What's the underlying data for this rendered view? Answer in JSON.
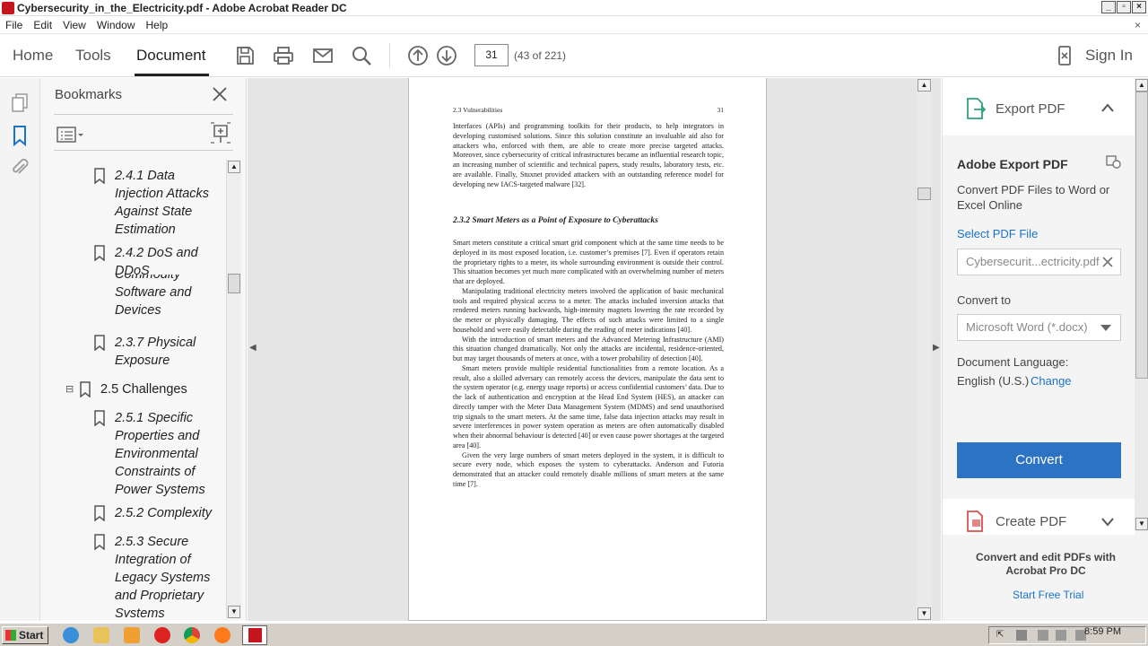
{
  "window": {
    "title": "Cybersecurity_in_the_Electricity.pdf - Adobe Acrobat Reader DC",
    "controls": [
      "_",
      "▫",
      "×"
    ]
  },
  "menu": {
    "items": [
      "File",
      "Edit",
      "View",
      "Window",
      "Help"
    ],
    "close": "×"
  },
  "toolbar": {
    "tabs": [
      "Home",
      "Tools",
      "Document"
    ],
    "active_tab": "Document",
    "page_value": "31",
    "page_count": "(43 of 221)",
    "sign_in": "Sign In"
  },
  "bookmarks": {
    "title": "Bookmarks",
    "items": [
      {
        "label": "2.4.1 Data\nInjection Attacks\nAgainst State\nEstimation"
      },
      {
        "label": "2.4.2 DoS and\nDDoS"
      },
      {
        "label": "Commodity\nSoftware and\nDevices"
      },
      {
        "label": "2.3.7 Physical\nExposure"
      },
      {
        "label": "2.5 Challenges",
        "toggle": "⊟"
      },
      {
        "label": "2.5.1 Specific\nProperties and\nEnvironmental\nConstraints of\nPower Systems"
      },
      {
        "label": "2.5.2 Complexity"
      },
      {
        "label": "2.5.3 Secure\nIntegration of\nLegacy Systems\nand Proprietary\nSystems"
      }
    ]
  },
  "document": {
    "header_left": "2.3 Vulnerabilities",
    "header_right": "31",
    "para0": "Interfaces (APIs) and programming toolkits for their products, to help integrators in developing customised solutions. Since this solution constitute an invaluable aid also for attackers who, enforced with them, are able to create more precise targeted attacks. Moreover, since cybersecurity of critical infrastructures became an influential research topic, an increasing number of scientific and technical papers, study results, laboratory tests, etc. are available. Finally, Stuxnet provided attackers with an outstanding reference model for developing new IACS-targeted malware [32].",
    "section_heading": "2.3.2  Smart Meters as a Point of Exposure to Cyberattacks",
    "paragraphs": [
      "Smart meters constitute a critical smart grid component which at the same time needs to be deployed in its most exposed location, i.e. customer’s premises [7]. Even if operators retain the proprietary rights to a meter, its whole surrounding environment is outside their control. This situation becomes yet much more complicated with an overwhelming number of meters that are deployed.",
      "Manipulating traditional electricity meters involved the application of basic mechanical tools and required physical access to a meter. The attacks included inversion attacks that rendered meters running backwards, high-intensity magnets lowering the rate recorded by the meter or physically damaging. The effects of such attacks were limited to a single household and were easily detectable during the reading of meter indications [40].",
      "With the introduction of smart meters and the Advanced Metering Infrastructure (AMI) this situation changed dramatically. Not only the attacks are incidental, residence-oriented, but may target thousands of meters at once, with a tower probability of detection [40].",
      "Smart meters provide multiple residential functionalities from a remote location. As a result, also a skilled adversary can remotely access the devices, manipulate the data sent to the system operator (e.g. energy usage reports) or access confidential customers’ data. Due to the lack of authentication and encryption at the Head End System (HES), an attacker can directly tamper with the Meter Data Management System (MDMS) and send unauthorised trip signals to the smart meters. At the same time, false data injection attacks may result in severe interferences in power system operation as meters are often automatically disabled when their abnormal behaviour is detected [40] or even cause power shortages at the targeted area [40].",
      "Given the very large numbers of smart meters deployed in the system, it is difficult to secure every node, which exposes the system to cyberattacks. Anderson and Futoria demonstrated that an attacker could remotely disable millions of smart meters at the same time [7]."
    ]
  },
  "right_panel": {
    "export_header": "Export PDF",
    "card_title": "Adobe Export PDF",
    "card_desc": "Convert PDF Files to Word or Excel Online",
    "select_file": "Select PDF File",
    "file_name": "Cybersecurit...ectricity.pdf",
    "convert_to_label": "Convert to",
    "convert_to_value": "Microsoft Word (*.docx)",
    "doc_lang_label": "Document Language:",
    "doc_lang_value": "English (U.S.)",
    "change": "Change",
    "convert_button": "Convert",
    "create_header": "Create PDF",
    "promo": "Convert and edit PDFs with Acrobat Pro DC",
    "trial": "Start Free Trial"
  },
  "taskbar": {
    "start": "Start",
    "clock": "8:59 PM"
  },
  "colors": {
    "accent": "#2d73c4",
    "link": "#1a73c8",
    "acrobat_red": "#c4161c"
  }
}
